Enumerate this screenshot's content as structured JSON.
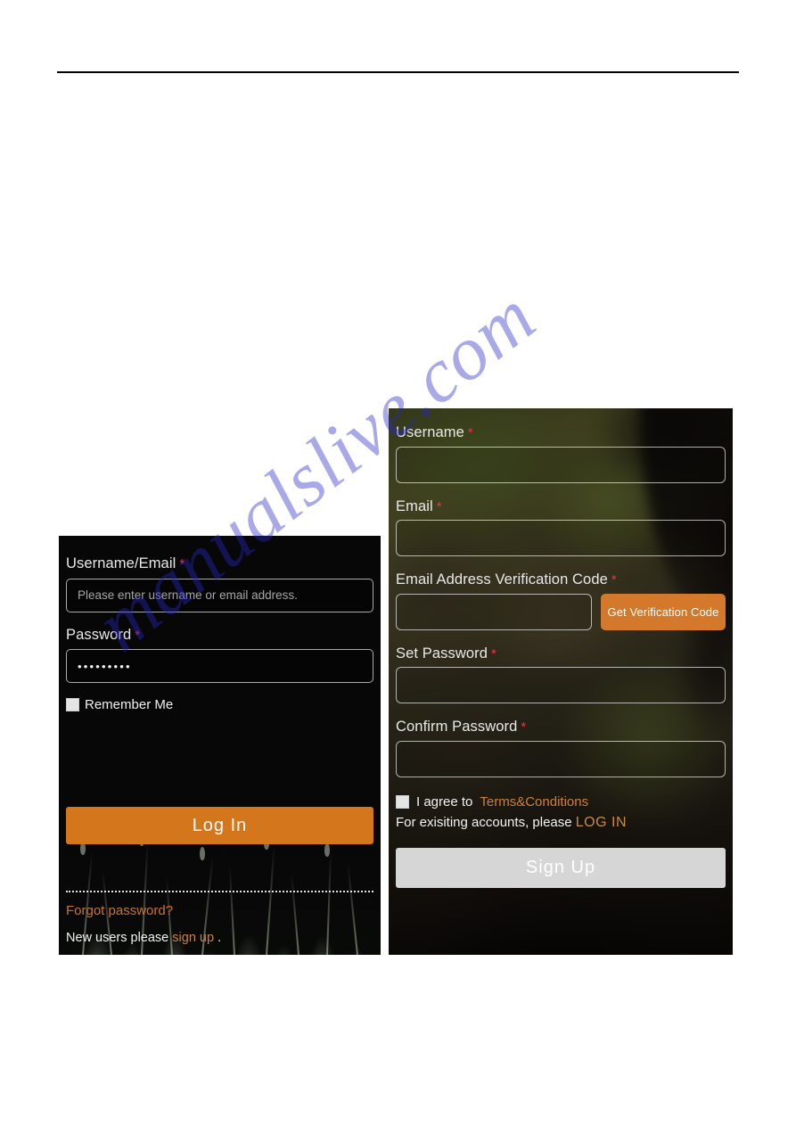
{
  "page": {
    "watermark": "manualslive.com",
    "watermark_color": "#2828c8",
    "background_color": "#ffffff",
    "rule_color": "#000000"
  },
  "login_panel": {
    "username": {
      "label": "Username/Email",
      "required_marker": "*",
      "placeholder": "Please enter username or email address.",
      "value": ""
    },
    "password": {
      "label": "Password",
      "required_marker": "*",
      "value": "•••••••••",
      "masked_char_count": 9
    },
    "remember_me": {
      "label": "Remember Me",
      "checked": false
    },
    "login_button": {
      "label": "Log    In",
      "color": "#d3761c",
      "text_color": "#ffffff"
    },
    "forgot_password_link": "Forgot password?",
    "new_users_prefix": "New users please",
    "sign_up_link": "sign up",
    "new_users_suffix": ".",
    "link_color": "#cf8135"
  },
  "signup_panel": {
    "username": {
      "label": "Username",
      "required_marker": "*",
      "value": ""
    },
    "email": {
      "label": "Email",
      "required_marker": "*",
      "value": ""
    },
    "verification_code": {
      "label": "Email Address Verification Code",
      "required_marker": "*",
      "value": "",
      "button_label": "Get Verification Code",
      "button_color": "#d4782b"
    },
    "set_password": {
      "label": "Set Password",
      "required_marker": "*",
      "value": ""
    },
    "confirm_password": {
      "label": "Confirm Password",
      "required_marker": "*",
      "value": ""
    },
    "agree": {
      "prefix": "I agree to",
      "terms_link": "Terms&Conditions",
      "checked": false
    },
    "existing_account": {
      "prefix": "For exisiting accounts, please",
      "login_link": "LOG IN"
    },
    "signup_button": {
      "label": "Sign    Up",
      "color": "#d6d6d6",
      "text_color": "#ffffff",
      "state": "disabled"
    }
  }
}
